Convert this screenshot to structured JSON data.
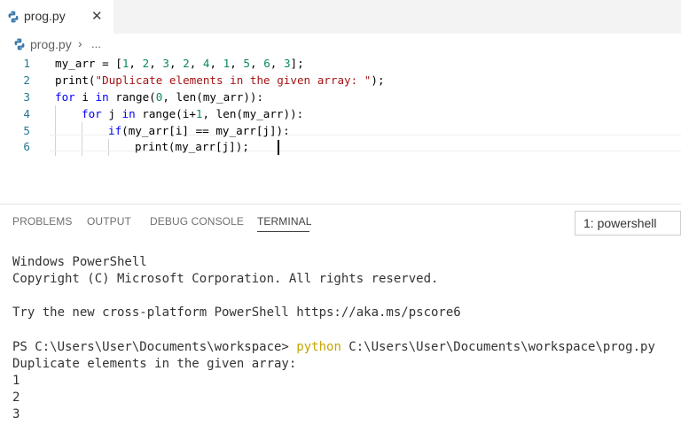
{
  "tab": {
    "title": "prog.py",
    "icon": "python-icon",
    "close": "✕"
  },
  "breadcrumb": {
    "file": "prog.py",
    "separator": "›",
    "more": "..."
  },
  "editor": {
    "lines": [
      {
        "num": "1",
        "text": "my_arr = [1, 2, 3, 2, 4, 1, 5, 6, 3];"
      },
      {
        "num": "2",
        "text": "print(\"Duplicate elements in the given array: \");"
      },
      {
        "num": "3",
        "text": "for i in range(0, len(my_arr)):"
      },
      {
        "num": "4",
        "text": "    for j in range(i+1, len(my_arr)):"
      },
      {
        "num": "5",
        "text": "        if(my_arr[i] == my_arr[j]):"
      },
      {
        "num": "6",
        "text": "            print(my_arr[j]);"
      }
    ],
    "tokens": {
      "l1": [
        "my_arr = [",
        "1",
        ", ",
        "2",
        ", ",
        "3",
        ", ",
        "2",
        ", ",
        "4",
        ", ",
        "1",
        ", ",
        "5",
        ", ",
        "6",
        ", ",
        "3",
        "];"
      ],
      "l2": [
        "print(",
        "\"Duplicate elements in the given array: \"",
        ");"
      ],
      "l3": [
        "for",
        " i ",
        "in",
        " range(",
        "0",
        ", len(my_arr)):"
      ],
      "l4": [
        "for",
        " j ",
        "in",
        " range(i+",
        "1",
        ", len(my_arr)):"
      ],
      "l5": [
        "if",
        "(my_arr[i] == my_arr[j]):"
      ],
      "l6": [
        "print(my_arr[j]);"
      ]
    },
    "colors": {
      "keyword": "#0000ff",
      "string": "#a31515",
      "number": "#09885a",
      "line_number": "#237893"
    }
  },
  "panel": {
    "tabs": [
      "PROBLEMS",
      "OUTPUT",
      "DEBUG CONSOLE",
      "TERMINAL"
    ],
    "active_tab": "TERMINAL",
    "terminal_select": "1: powershell"
  },
  "terminal": {
    "header1": "Windows PowerShell",
    "header2": "Copyright (C) Microsoft Corporation. All rights reserved.",
    "tip": "Try the new cross-platform PowerShell https://aka.ms/pscore6",
    "prompt": "PS C:\\Users\\User\\Documents\\workspace> ",
    "cmd_name": "python",
    "cmd_arg": " C:\\Users\\User\\Documents\\workspace\\prog.py",
    "out_title": "Duplicate elements in the given array:",
    "outputs": [
      "1",
      "2",
      "3"
    ],
    "command_color": "#c5a502"
  }
}
